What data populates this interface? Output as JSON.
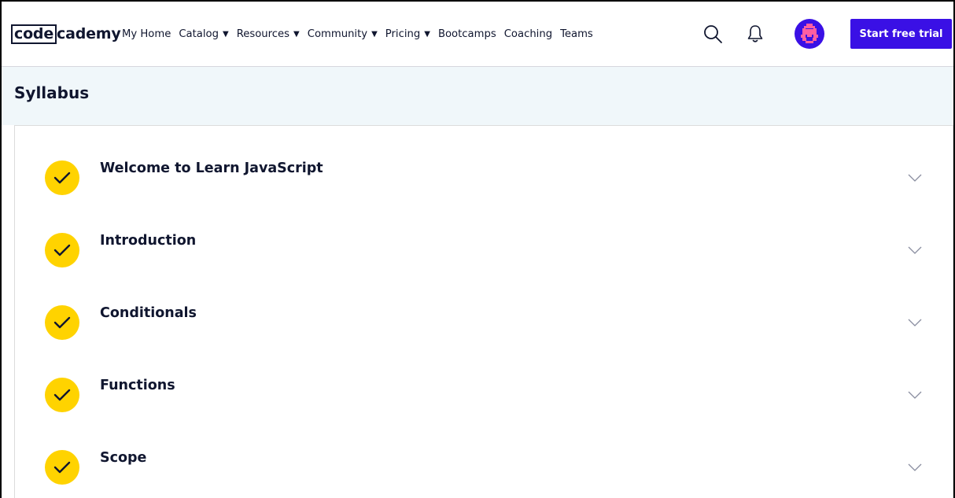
{
  "header": {
    "logo_box": "code",
    "logo_rest": "cademy",
    "nav": [
      {
        "label": "My Home",
        "has_caret": false
      },
      {
        "label": "Catalog",
        "has_caret": true
      },
      {
        "label": "Resources",
        "has_caret": true
      },
      {
        "label": "Community",
        "has_caret": true
      },
      {
        "label": "Pricing",
        "has_caret": true
      },
      {
        "label": "Bootcamps",
        "has_caret": false
      },
      {
        "label": "Coaching",
        "has_caret": false
      },
      {
        "label": "Teams",
        "has_caret": false
      }
    ],
    "caret_glyph": "▼",
    "icons": [
      "search-icon",
      "bell-icon",
      "avatar"
    ],
    "cta_label": "Start free trial"
  },
  "syllabus": {
    "title": "Syllabus",
    "modules": [
      {
        "title": "Welcome to Learn JavaScript",
        "completed": true
      },
      {
        "title": "Introduction",
        "completed": true
      },
      {
        "title": "Conditionals",
        "completed": true
      },
      {
        "title": "Functions",
        "completed": true
      },
      {
        "title": "Scope",
        "completed": true
      }
    ]
  },
  "colors": {
    "accent": "#3a10e5",
    "check_yellow": "#ffd300",
    "band_bg": "#f0f7fa",
    "text": "#10162f",
    "avatar_pixels": "#ff5fa2"
  }
}
